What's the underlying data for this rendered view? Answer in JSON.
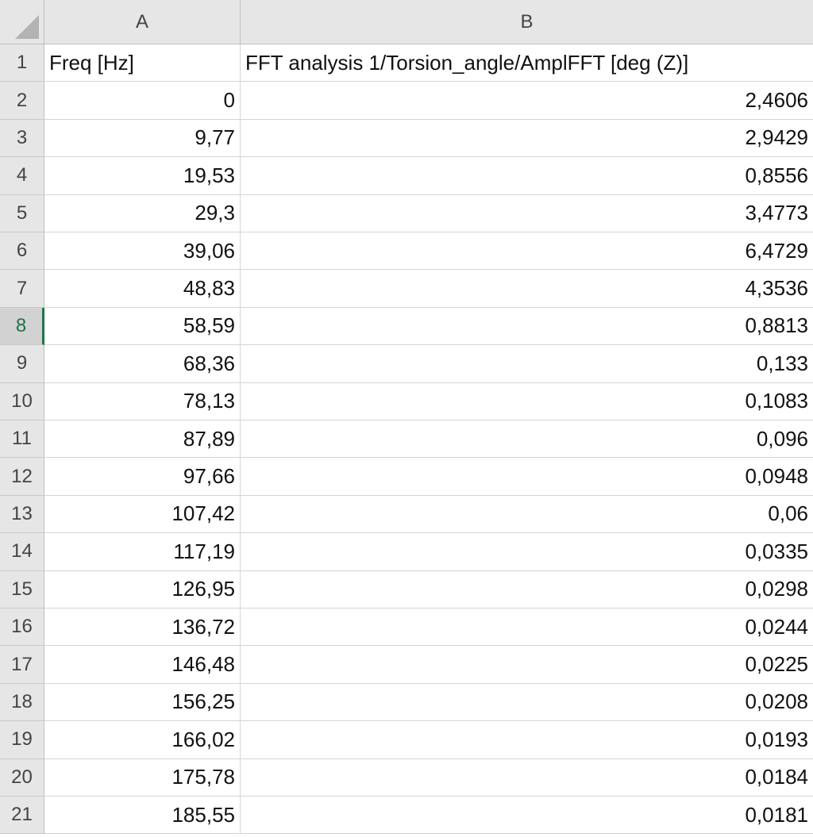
{
  "columns": [
    "A",
    "B"
  ],
  "rows": [
    {
      "num": "1",
      "a": "Freq [Hz]",
      "b": "FFT analysis 1/Torsion_angle/AmplFFT [deg (Z)]"
    },
    {
      "num": "2",
      "a": "0",
      "b": "2,4606"
    },
    {
      "num": "3",
      "a": "9,77",
      "b": "2,9429"
    },
    {
      "num": "4",
      "a": "19,53",
      "b": "0,8556"
    },
    {
      "num": "5",
      "a": "29,3",
      "b": "3,4773"
    },
    {
      "num": "6",
      "a": "39,06",
      "b": "6,4729"
    },
    {
      "num": "7",
      "a": "48,83",
      "b": "4,3536"
    },
    {
      "num": "8",
      "a": "58,59",
      "b": "0,8813"
    },
    {
      "num": "9",
      "a": "68,36",
      "b": "0,133"
    },
    {
      "num": "10",
      "a": "78,13",
      "b": "0,1083"
    },
    {
      "num": "11",
      "a": "87,89",
      "b": "0,096"
    },
    {
      "num": "12",
      "a": "97,66",
      "b": "0,0948"
    },
    {
      "num": "13",
      "a": "107,42",
      "b": "0,06"
    },
    {
      "num": "14",
      "a": "117,19",
      "b": "0,0335"
    },
    {
      "num": "15",
      "a": "126,95",
      "b": "0,0298"
    },
    {
      "num": "16",
      "a": "136,72",
      "b": "0,0244"
    },
    {
      "num": "17",
      "a": "146,48",
      "b": "0,0225"
    },
    {
      "num": "18",
      "a": "156,25",
      "b": "0,0208"
    },
    {
      "num": "19",
      "a": "166,02",
      "b": "0,0193"
    },
    {
      "num": "20",
      "a": "175,78",
      "b": "0,0184"
    },
    {
      "num": "21",
      "a": "185,55",
      "b": "0,0181"
    }
  ],
  "active_row": "8"
}
